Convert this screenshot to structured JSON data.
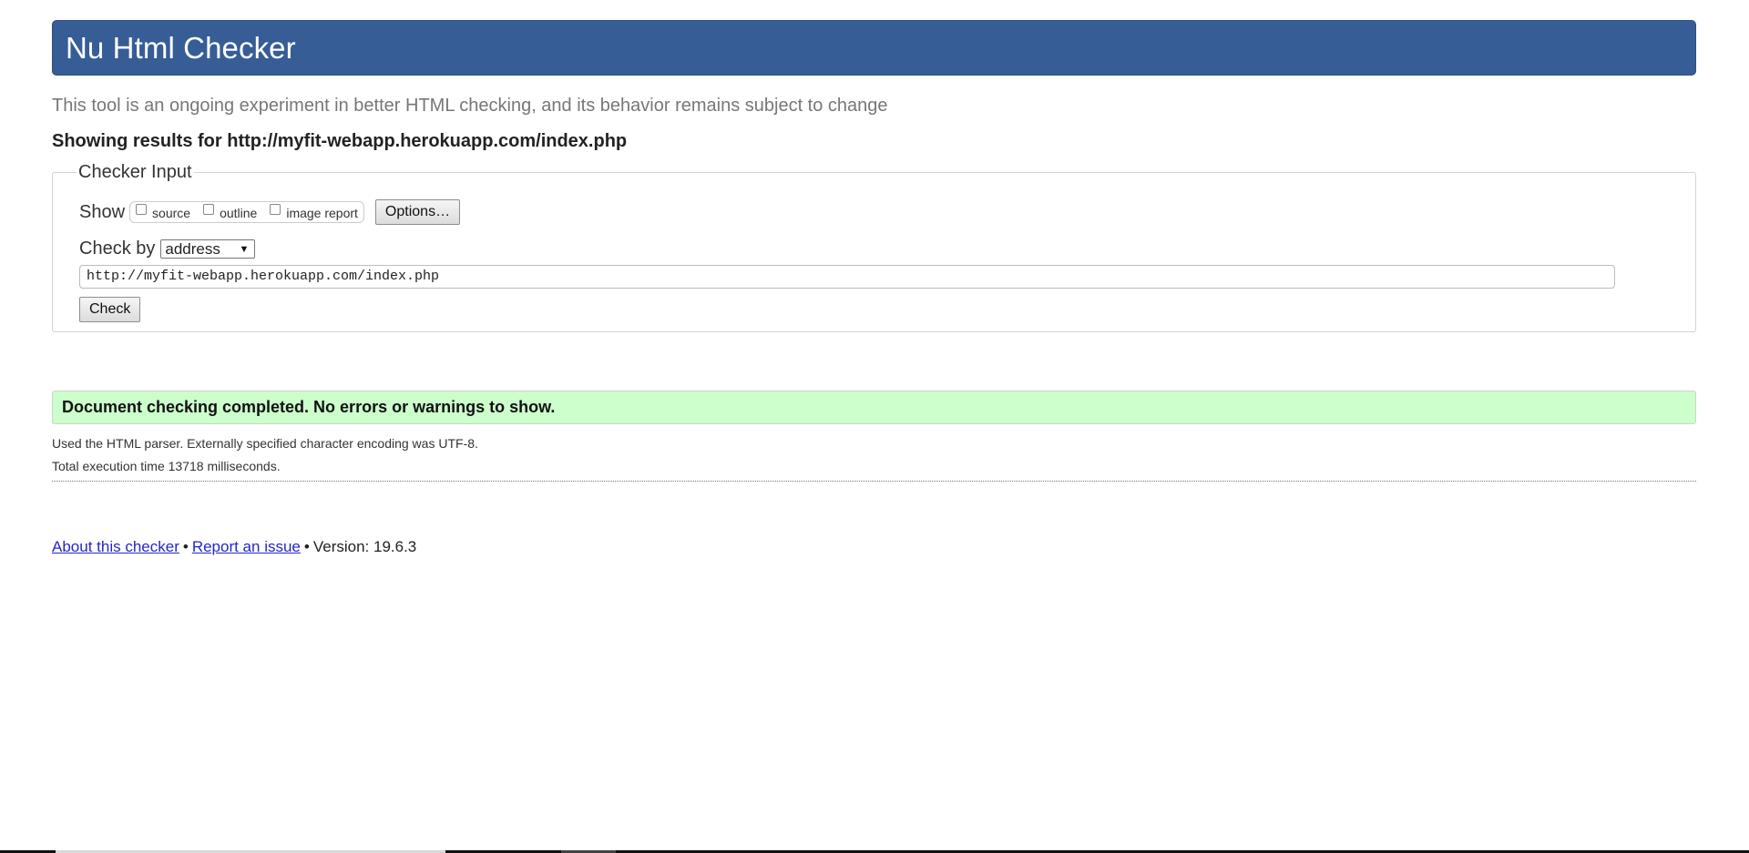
{
  "header": {
    "title": "Nu Html Checker"
  },
  "intro_text": "This tool is an ongoing experiment in better HTML checking, and its behavior remains subject to change",
  "results_for": "Showing results for http://myfit-webapp.herokuapp.com/index.php",
  "checker": {
    "legend": "Checker Input",
    "show_label": "Show",
    "checkboxes": {
      "source": "source",
      "outline": "outline",
      "image_report": "image report"
    },
    "options_button": "Options…",
    "check_by_label": "Check by",
    "check_by_value": "address",
    "url_value": "http://myfit-webapp.herokuapp.com/index.php",
    "check_button": "Check"
  },
  "result": {
    "message": "Document checking completed. No errors or warnings to show.",
    "parser_info": "Used the HTML parser. Externally specified character encoding was UTF-8.",
    "execution_time": "Total execution time 13718 milliseconds."
  },
  "footer": {
    "about_link": "About this checker",
    "bullet1": "•",
    "report_link": "Report an issue",
    "bullet2": "•",
    "version": "Version: 19.6.3"
  },
  "colors": {
    "header_bg": "#365d95",
    "success_bg": "#ccffcc",
    "link": "#2525cc"
  }
}
